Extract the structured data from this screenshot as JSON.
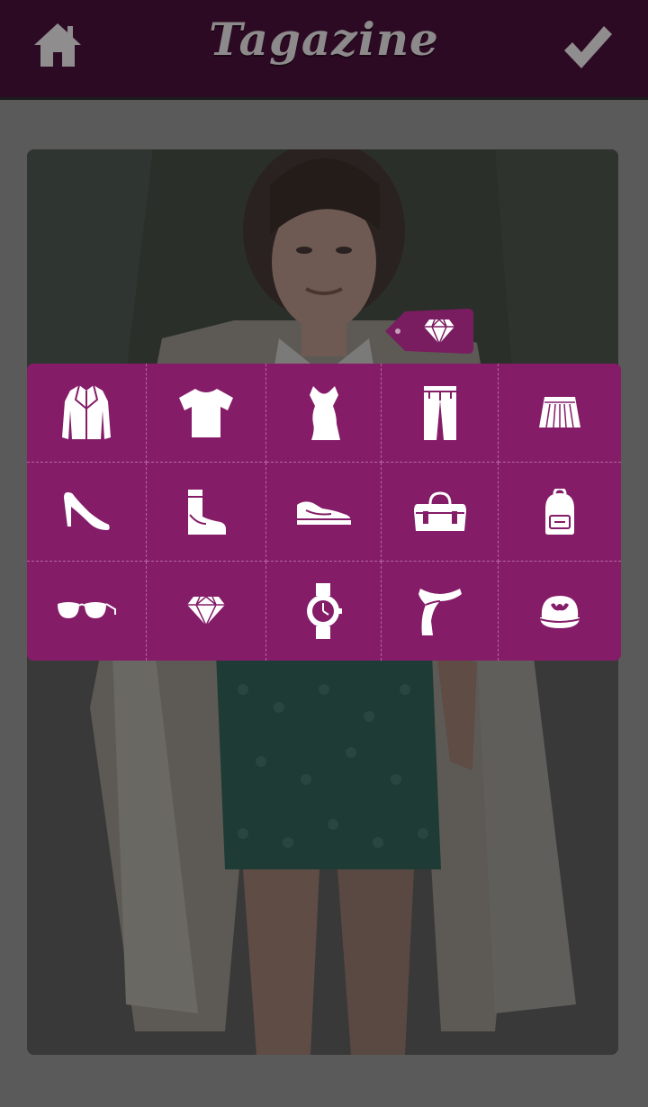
{
  "header": {
    "brand": "Tagazine",
    "home_icon": "home-icon",
    "confirm_icon": "checkmark-icon"
  },
  "colors": {
    "header_bg": "#2d0a24",
    "panel_bg": "#841c68",
    "tag_bg": "#7a1c60",
    "page_bg": "#5a5a5a",
    "icon": "#ffffff"
  },
  "photo_tag": {
    "icon": "diamond-icon"
  },
  "category_grid": [
    {
      "icon": "jacket-icon"
    },
    {
      "icon": "tshirt-icon"
    },
    {
      "icon": "dress-icon"
    },
    {
      "icon": "pants-icon"
    },
    {
      "icon": "skirt-icon"
    },
    {
      "icon": "high-heel-icon"
    },
    {
      "icon": "boot-icon"
    },
    {
      "icon": "sneaker-icon"
    },
    {
      "icon": "handbag-icon"
    },
    {
      "icon": "backpack-icon"
    },
    {
      "icon": "sunglasses-icon"
    },
    {
      "icon": "diamond-icon"
    },
    {
      "icon": "watch-icon"
    },
    {
      "icon": "scarf-icon"
    },
    {
      "icon": "cap-icon"
    }
  ]
}
